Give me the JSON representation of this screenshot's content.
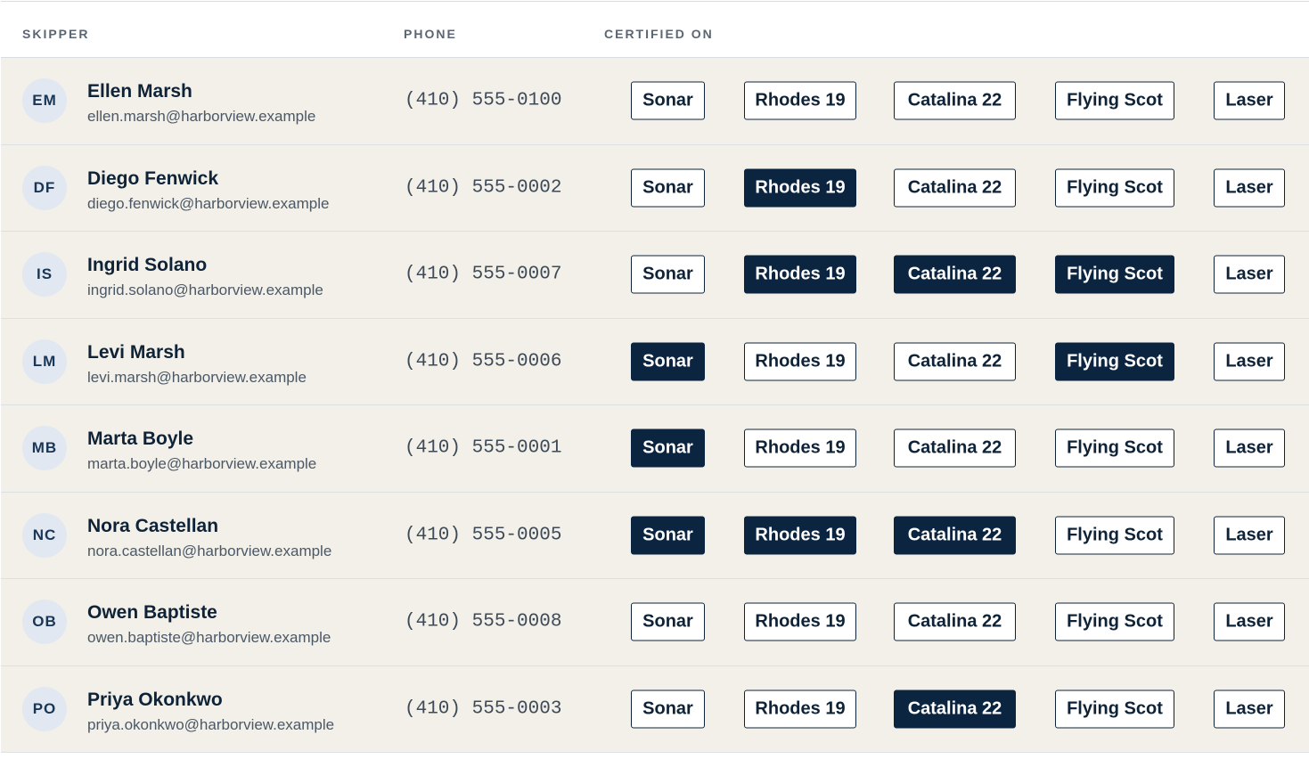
{
  "header": {
    "skipper": "SKIPPER",
    "phone": "PHONE",
    "certified_on": "CERTIFIED ON"
  },
  "boat_classes": [
    "Sonar",
    "Rhodes 19",
    "Catalina 22",
    "Flying Scot",
    "Laser"
  ],
  "colors": {
    "row_background": "#f2f0e9",
    "chip_selected": "#0b2440",
    "chip_border": "#0f2338",
    "avatar_background": "#e1e8f1"
  },
  "skippers": [
    {
      "initials": "EM",
      "name": "Ellen Marsh",
      "email": "ellen.marsh@harborview.example",
      "phone": "(410) 555-0100",
      "certified": [
        false,
        false,
        false,
        false,
        false
      ]
    },
    {
      "initials": "DF",
      "name": "Diego Fenwick",
      "email": "diego.fenwick@harborview.example",
      "phone": "(410) 555-0002",
      "certified": [
        false,
        true,
        false,
        false,
        false
      ]
    },
    {
      "initials": "IS",
      "name": "Ingrid Solano",
      "email": "ingrid.solano@harborview.example",
      "phone": "(410) 555-0007",
      "certified": [
        false,
        true,
        true,
        true,
        false
      ]
    },
    {
      "initials": "LM",
      "name": "Levi Marsh",
      "email": "levi.marsh@harborview.example",
      "phone": "(410) 555-0006",
      "certified": [
        true,
        false,
        false,
        true,
        false
      ]
    },
    {
      "initials": "MB",
      "name": "Marta Boyle",
      "email": "marta.boyle@harborview.example",
      "phone": "(410) 555-0001",
      "certified": [
        true,
        false,
        false,
        false,
        false
      ]
    },
    {
      "initials": "NC",
      "name": "Nora Castellan",
      "email": "nora.castellan@harborview.example",
      "phone": "(410) 555-0005",
      "certified": [
        true,
        true,
        true,
        false,
        false
      ]
    },
    {
      "initials": "OB",
      "name": "Owen Baptiste",
      "email": "owen.baptiste@harborview.example",
      "phone": "(410) 555-0008",
      "certified": [
        false,
        false,
        false,
        false,
        false
      ]
    },
    {
      "initials": "PO",
      "name": "Priya Okonkwo",
      "email": "priya.okonkwo@harborview.example",
      "phone": "(410) 555-0003",
      "certified": [
        false,
        false,
        true,
        false,
        false
      ]
    }
  ]
}
